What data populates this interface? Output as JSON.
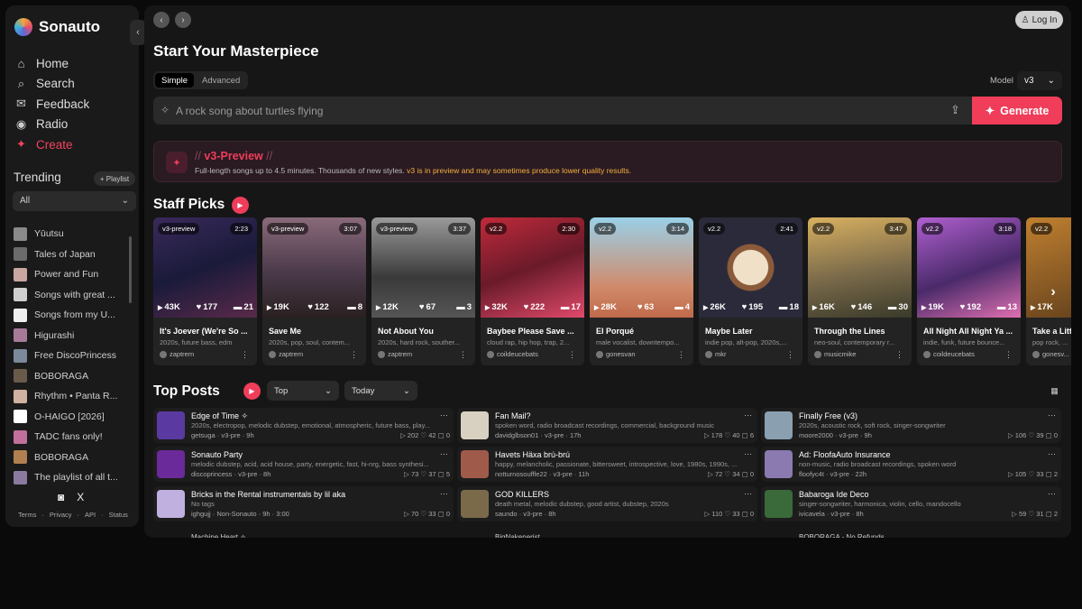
{
  "app": {
    "name": "Sonauto",
    "collapse": "‹"
  },
  "nav": [
    {
      "label": "Home",
      "icon": "⌂",
      "name": "home"
    },
    {
      "label": "Search",
      "icon": "⌕",
      "name": "search"
    },
    {
      "label": "Feedback",
      "icon": "✉",
      "name": "feedback"
    },
    {
      "label": "Radio",
      "icon": "◉",
      "name": "radio"
    },
    {
      "label": "Create",
      "icon": "✦",
      "name": "create"
    }
  ],
  "trending": {
    "title": "Trending",
    "playlist_btn": "+ Playlist",
    "filter": "All",
    "items": [
      {
        "label": "Yūutsu",
        "color": "#8a8a8a"
      },
      {
        "label": "Tales of Japan",
        "color": "#6b6b6b"
      },
      {
        "label": "Power and Fun",
        "color": "#c9a7a0"
      },
      {
        "label": "Songs with great ...",
        "color": "#cfcfcf"
      },
      {
        "label": "Songs from my U...",
        "color": "#eeeeee"
      },
      {
        "label": "Higurashi",
        "color": "#a77a9a"
      },
      {
        "label": "Free DiscoPrincess",
        "color": "#7a8a9a"
      },
      {
        "label": "BOBORAGA",
        "color": "#6a5a4a"
      },
      {
        "label": "Rhythm • Panta R...",
        "color": "#d0b0a0"
      },
      {
        "label": "O-HAIGO [2026]",
        "color": "#ffffff"
      },
      {
        "label": "TADC fans only!",
        "color": "#c0709a"
      },
      {
        "label": "BOBORAGA",
        "color": "#b08050"
      },
      {
        "label": "The playlist of all t...",
        "color": "#8a7aa0"
      }
    ]
  },
  "social": [
    "◙",
    "X"
  ],
  "footer": [
    "Terms",
    "·",
    "Privacy",
    "·",
    "API",
    "·",
    "Status"
  ],
  "header": {
    "back": "‹",
    "forward": "›",
    "login": "Log In",
    "login_icon": "♙"
  },
  "create": {
    "title": "Start Your Masterpiece",
    "tabs": [
      "Simple",
      "Advanced"
    ],
    "model_label": "Model",
    "model_value": "v3",
    "placeholder": "A rock song about turtles flying",
    "generate": "Generate"
  },
  "banner": {
    "prefix": "// ",
    "title": "v3-Preview",
    "suffix": " //",
    "desc": "Full-length songs up to 4.5 minutes. Thousands of new styles. ",
    "desc_warn": "v3 is in preview and may sometimes produce lower quality results."
  },
  "staff": {
    "title": "Staff Picks",
    "cards": [
      {
        "ver": "v3-preview",
        "dur": "2:23",
        "plays": "43K",
        "likes": "177",
        "comments": "21",
        "title": "It's Joever (We're So ...",
        "tags": "2020s, future bass, edm",
        "user": "zaptrem",
        "bg": "linear-gradient(160deg,#3a2a5a,#1a1a3a 50%,#5a2a4a)"
      },
      {
        "ver": "v3-preview",
        "dur": "3:07",
        "plays": "19K",
        "likes": "122",
        "comments": "8",
        "title": "Save Me",
        "tags": "2020s, pop, soul, contem...",
        "user": "zaptrem",
        "bg": "linear-gradient(180deg,#8a6a7a,#4a3a4a 55%,#2a2020)"
      },
      {
        "ver": "v3-preview",
        "dur": "3:37",
        "plays": "12K",
        "likes": "67",
        "comments": "3",
        "title": "Not About You",
        "tags": "2020s, hard rock, souther...",
        "user": "zaptrem",
        "bg": "linear-gradient(180deg,#9a9a9a,#3a3a3a 60%,#555)"
      },
      {
        "ver": "v2.2",
        "dur": "2:30",
        "plays": "32K",
        "likes": "222",
        "comments": "17",
        "title": "Baybee Please Save ...",
        "tags": "cloud rap, hip hop, trap, 2...",
        "user": "coildeucebats",
        "bg": "linear-gradient(160deg,#c02a3a,#6a1a2a 50%,#e04a6a)"
      },
      {
        "ver": "v2.2",
        "dur": "3:14",
        "plays": "28K",
        "likes": "63",
        "comments": "4",
        "title": "El Porqué",
        "tags": "male vocalist, downtempo...",
        "user": "gonesvan",
        "bg": "linear-gradient(180deg,#9ad0e8,#d08a6a 70%,#c06a4a)"
      },
      {
        "ver": "v2.2",
        "dur": "2:41",
        "plays": "26K",
        "likes": "195",
        "comments": "18",
        "title": "Maybe Later",
        "tags": "indie pop, alt-pop, 2020s,...",
        "user": "mkr",
        "bg": "radial-gradient(circle at 50% 50%,#f0e0c8 0 24%,#8a5a3a 25% 32%,#2a2a3a 33%)"
      },
      {
        "ver": "v2.2",
        "dur": "3:47",
        "plays": "16K",
        "likes": "146",
        "comments": "30",
        "title": "Through the Lines",
        "tags": "neo-soul, contemporary r...",
        "user": "musicmike",
        "bg": "linear-gradient(170deg,#d8b060,#7a6a4a 55%,#3a3a2a)"
      },
      {
        "ver": "v2.2",
        "dur": "3:18",
        "plays": "19K",
        "likes": "192",
        "comments": "13",
        "title": "All Night All Night Ya ...",
        "tags": "indie, funk, future bounce...",
        "user": "coildeucebats",
        "bg": "linear-gradient(160deg,#b060d0,#4a2a6a 55%,#e070b0)"
      },
      {
        "ver": "v2.2",
        "dur": "",
        "plays": "17K",
        "likes": "",
        "comments": "",
        "title": "Take a Litt...",
        "tags": "pop rock, ...",
        "user": "gonesv...",
        "bg": "linear-gradient(160deg,#c08030,#5a3a1a)"
      }
    ]
  },
  "top": {
    "title": "Top Posts",
    "sort": "Top",
    "range": "Today",
    "posts": [
      {
        "title": "Edge of Time ✧",
        "tags": "2020s, electropop, melodic dubstep, emotional, atmospheric, future bass, play...",
        "user": "getsuga",
        "meta": " · v3-pre · 9h",
        "plays": "202",
        "likes": "42",
        "comments": "0",
        "color": "#5a3aa0"
      },
      {
        "title": "Fan Mail?",
        "tags": "spoken word, radio broadcast recordings, commercial, background music",
        "user": "davidglbson01",
        "meta": " · v3-pre · 17h",
        "plays": "178",
        "likes": "40",
        "comments": "6",
        "color": "#d8d0c0"
      },
      {
        "title": "Finally Free (v3)",
        "tags": "2020s, acoustic rock, soft rock, singer-songwriter",
        "user": "moore2000",
        "meta": " · v3-pre · 9h",
        "plays": "106",
        "likes": "39",
        "comments": "0",
        "color": "#8aa0b0"
      },
      {
        "title": "Sonauto Party",
        "tags": "melodic dubstep, acid, acid house, party, energetic, fast, hi-nrg, bass synthesi...",
        "user": "discoprincess",
        "meta": " · v3-pre · 8h",
        "plays": "73",
        "likes": "37",
        "comments": "5",
        "color": "#6a2a9a"
      },
      {
        "title": "Havets Häxa brú-brú",
        "tags": "happy, melancholic, passionate, bittersweet, introspective, love, 1980s, 1990s, ...",
        "user": "notturnosouffle22",
        "meta": " · v3-pre · 11h",
        "plays": "72",
        "likes": "34",
        "comments": "0",
        "color": "#a05a4a"
      },
      {
        "title": "Ad: FloofaAuto Insurance",
        "tags": "non-music, radio broadcast recordings, spoken word",
        "user": "floofyc4t",
        "meta": " · v3-pre · 22h",
        "plays": "105",
        "likes": "33",
        "comments": "2",
        "color": "#8a7ab0"
      },
      {
        "title": "Bricks in the Rental instrumentals by lil aka",
        "tags": "No tags",
        "user": "ighgujj",
        "meta": " · Non-Sonauto · 9h · 3:00",
        "plays": "70",
        "likes": "33",
        "comments": "0",
        "color": "#c0b0e0"
      },
      {
        "title": "GOD KILLERS",
        "tags": "death metal, melodic dubstep, good artist, dubstep, 2020s",
        "user": "saundo",
        "meta": " · v3-pre · 8h",
        "plays": "110",
        "likes": "33",
        "comments": "0",
        "color": "#7a6a4a"
      },
      {
        "title": "Babaroga Ide Deco",
        "tags": "singer-songwriter, harmonica, violin, cello, mandocello",
        "user": "ivicavela",
        "meta": " · v3-pre · 8h",
        "plays": "59",
        "likes": "31",
        "comments": "2",
        "color": "#3a6a3a"
      }
    ],
    "partial": [
      "Machine Heart ✧",
      "BigNakenerist",
      "BOBORAGA - No Refunds"
    ]
  }
}
